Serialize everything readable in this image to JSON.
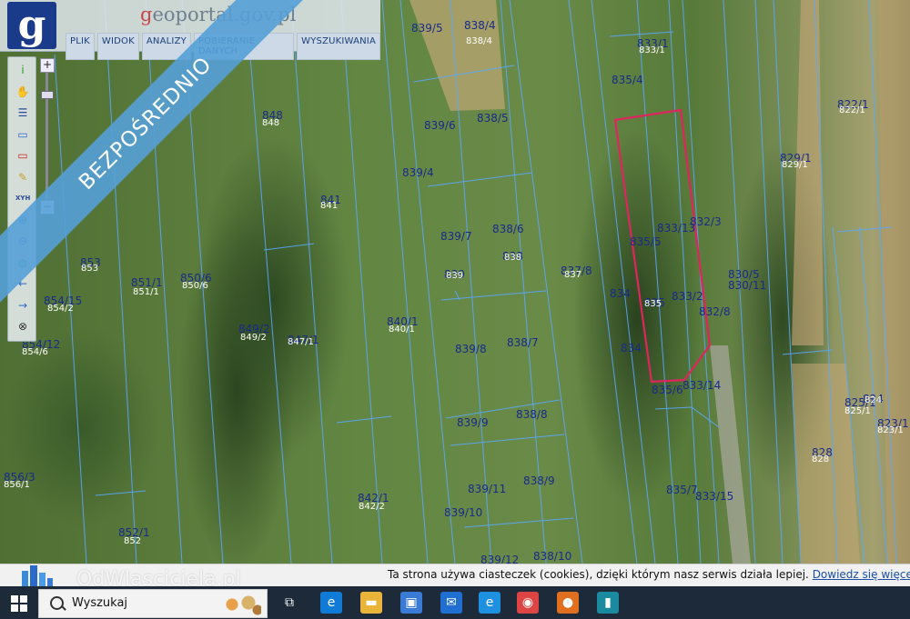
{
  "app": {
    "site_name_prefix": "g",
    "site_name_rest": "eoportal.gov.pl",
    "logo_letter": "g"
  },
  "menu": [
    "PLIK",
    "WIDOK",
    "ANALIZY",
    "POBIERANIE DANYCH",
    "WYSZUKIWANIA"
  ],
  "ribbon_text": "BEZPOŚREDNIO",
  "zoom": {
    "plus": "+",
    "minus": "−"
  },
  "tools": [
    {
      "name": "info-icon",
      "glyph": "i",
      "color": "#2a9a2a"
    },
    {
      "name": "pan-hand-icon",
      "glyph": "✋",
      "color": "#b98a3a"
    },
    {
      "name": "legend-icon",
      "glyph": "☰",
      "color": "#2a4a9a"
    },
    {
      "name": "select-area-icon",
      "glyph": "▭",
      "color": "#2a6aca"
    },
    {
      "name": "select-object-icon",
      "glyph": "▭",
      "color": "#cc2222"
    },
    {
      "name": "draw-pencil-icon",
      "glyph": "✎",
      "color": "#c8a030"
    },
    {
      "name": "xyh-coordinates-icon",
      "glyph": "XYH",
      "color": "#2a4a9a"
    },
    {
      "name": "zoom-in-icon",
      "glyph": "⊕",
      "color": "#2a6aca"
    },
    {
      "name": "zoom-out-icon",
      "glyph": "⊖",
      "color": "#2a6aca"
    },
    {
      "name": "globe-icon",
      "glyph": "◍",
      "color": "#2a8a6a"
    },
    {
      "name": "back-arrow-icon",
      "glyph": "←",
      "color": "#2a6aca"
    },
    {
      "name": "forward-arrow-icon",
      "glyph": "→",
      "color": "#2a6aca"
    },
    {
      "name": "close-circle-icon",
      "glyph": "⊗",
      "color": "#333333"
    }
  ],
  "parcel_labels": [
    "839/5",
    "838/4",
    "839/6",
    "838/5",
    "839/4",
    "839/7",
    "838/6",
    "839",
    "838",
    "839/8",
    "838/7",
    "839/9",
    "838/8",
    "839/11",
    "838/9",
    "839/10",
    "839/12",
    "838/10",
    "848",
    "841",
    "840/1",
    "847/1",
    "849/2",
    "842/1",
    "850/6",
    "851/1",
    "853",
    "854/15",
    "854/12",
    "856/3",
    "852/1",
    "835/4",
    "833/1",
    "835/5",
    "833/13",
    "832/3",
    "834",
    "835",
    "833/2",
    "832/8",
    "834",
    "835/6",
    "833/14",
    "835/7",
    "833/15",
    "837/8",
    "822/1",
    "829/1",
    "830/5",
    "830/11",
    "825/1",
    "824",
    "823/1",
    "828"
  ],
  "parcel_labels_small": [
    "838/4",
    "848",
    "841",
    "840/1",
    "839",
    "838",
    "837",
    "833/1",
    "822/1",
    "829/1",
    "850/6",
    "851/1",
    "853",
    "854/2",
    "854/6",
    "849/2",
    "847/1",
    "842/2",
    "856/1",
    "852",
    "835",
    "825/1",
    "828",
    "824",
    "823/1"
  ],
  "highlight_color": "#e0245e",
  "cookie": {
    "text": "Ta strona używa ciasteczek (cookies), dzięki którym nasz serwis działa lepiej.",
    "link": "Dowiedz się więcej"
  },
  "watermark": "OdWlasciciela.pl",
  "taskbar": {
    "search_label": "Wyszukaj",
    "apps": [
      {
        "name": "task-view-icon",
        "glyph": "⧉",
        "bg": "transparent"
      },
      {
        "name": "edge-browser-icon",
        "glyph": "e",
        "bg": "#0f7bd6"
      },
      {
        "name": "file-explorer-icon",
        "glyph": "▬",
        "bg": "#e8b53a"
      },
      {
        "name": "store-icon",
        "glyph": "▣",
        "bg": "#3a7bd5"
      },
      {
        "name": "mail-icon",
        "glyph": "✉",
        "bg": "#1e6fd0"
      },
      {
        "name": "internet-explorer-icon",
        "glyph": "e",
        "bg": "#1e90e0"
      },
      {
        "name": "chrome-icon",
        "glyph": "◉",
        "bg": "#d44"
      },
      {
        "name": "basketball-app-icon",
        "glyph": "●",
        "bg": "#e07020"
      },
      {
        "name": "terminal-app-icon",
        "glyph": "▮",
        "bg": "#1a8aa0"
      }
    ]
  }
}
